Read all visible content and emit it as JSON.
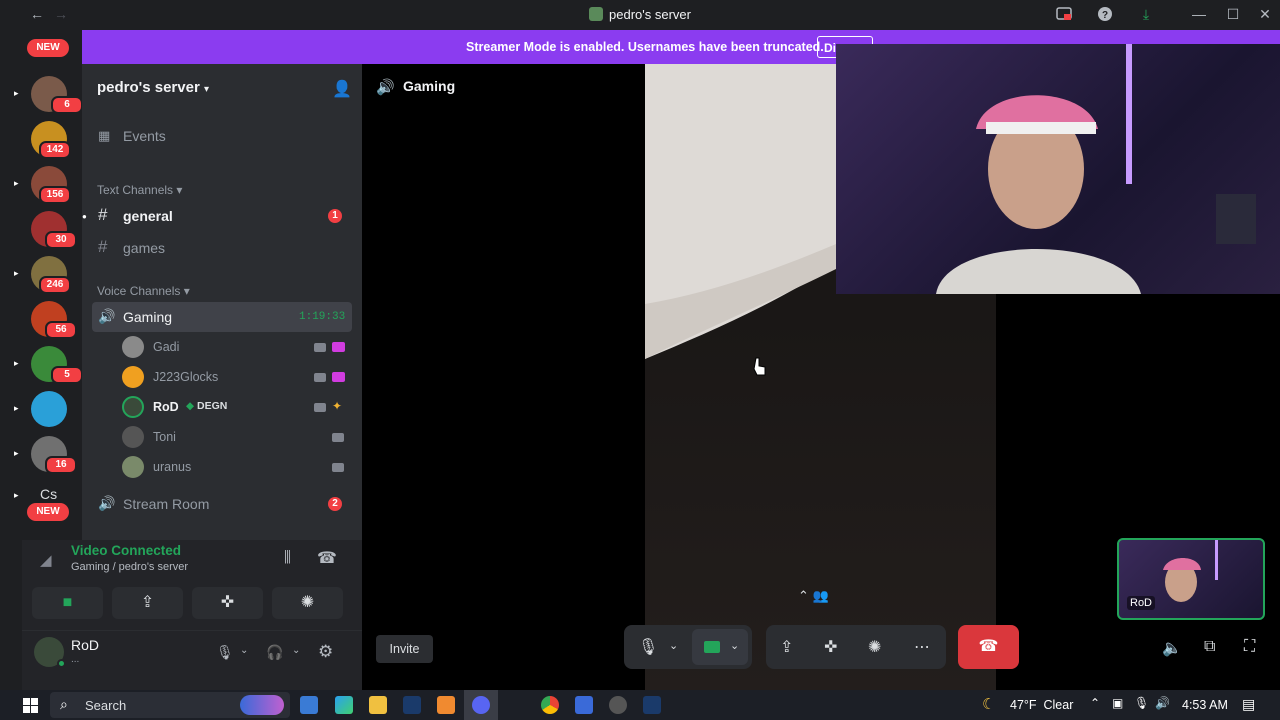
{
  "window": {
    "title": "pedro's server"
  },
  "banner": {
    "text": "Streamer Mode is enabled. Usernames have been truncated.",
    "button": "Di"
  },
  "rail": {
    "new_top": "NEW",
    "new_bottom": "NEW",
    "badges": [
      "6",
      "142",
      "156",
      "30",
      "246",
      "56",
      "5",
      "16"
    ],
    "cs_label": "Cs"
  },
  "sidebar": {
    "server_name": "pedro's server",
    "events": "Events",
    "text_category": "Text Channels",
    "text_channels": [
      {
        "name": "general",
        "badge": "1"
      },
      {
        "name": "games"
      }
    ],
    "voice_category": "Voice Channels",
    "voice_channel": {
      "name": "Gaming",
      "timer": "1:19:33"
    },
    "voice_users": [
      {
        "name": "Gadi"
      },
      {
        "name": "J223Glocks"
      },
      {
        "name": "RoD",
        "tag": "DEGN"
      },
      {
        "name": "Toni"
      },
      {
        "name": "uranus"
      }
    ],
    "stream_room": {
      "name": "Stream Room",
      "badge": "2"
    }
  },
  "voice_panel": {
    "status": "Video Connected",
    "location": "Gaming / pedro's server",
    "user_name": "RoD",
    "user_status": "..."
  },
  "stage": {
    "channel_title": "Gaming",
    "invite": "Invite",
    "self_tile_name": "RoD"
  },
  "taskbar": {
    "search": "Search",
    "weather": "47°F  Clear",
    "time": "4:53 AM"
  },
  "colors": {
    "accent": "#8b3cf0",
    "connected": "#23a55a",
    "danger": "#da373c"
  }
}
